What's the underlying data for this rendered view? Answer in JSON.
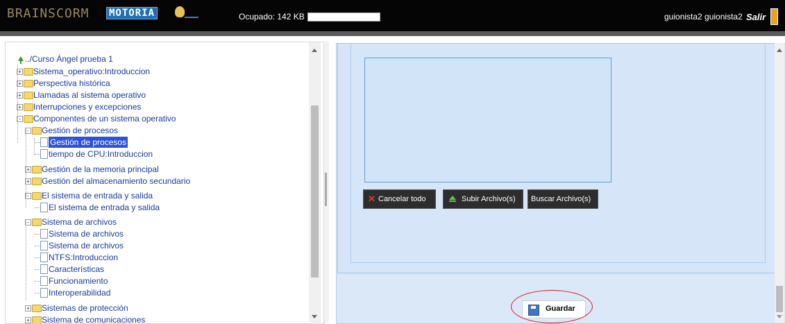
{
  "header": {
    "brand": "BRAINSCORM",
    "logo_text": "MOTORIA",
    "usage_text": "Ocupado: 142 KB",
    "usage_fraction": 1.0,
    "user_text": "guionista2 guionista2",
    "logout_label": "Salir",
    "colors": {
      "background": "#050505",
      "brand": "#9a8860",
      "logo": "#1f6fb5"
    }
  },
  "tree": {
    "root_label": "../Curso Ángel prueba 1",
    "nodes": [
      {
        "label": "Sistema_operativo:Introduccion",
        "type": "folder",
        "expander": "+"
      },
      {
        "label": "Perspectiva histórica",
        "type": "folder",
        "expander": "+"
      },
      {
        "label": "Llamadas al sistema operativo",
        "type": "folder",
        "expander": "+"
      },
      {
        "label": "Interrupciones y excepciones",
        "type": "folder",
        "expander": "+"
      },
      {
        "label": "Componentes de un sistema operativo",
        "type": "folder",
        "expander": "-"
      },
      {
        "label": "Gestión de procesos",
        "type": "folder",
        "expander": "-"
      },
      {
        "label": "Gestión de procesos",
        "type": "page",
        "selected": true
      },
      {
        "label": "tiempo de CPU:Introduccion",
        "type": "page"
      },
      {
        "label": "Gestión de la memoria principal",
        "type": "folder",
        "expander": "+"
      },
      {
        "label": "Gestión del almacenamiento secundario",
        "type": "folder",
        "expander": "+"
      },
      {
        "label": "El sistema de entrada y salida",
        "type": "folder",
        "expander": "-"
      },
      {
        "label": "El sistema de entrada y salida",
        "type": "page"
      },
      {
        "label": "Sistema de archivos",
        "type": "folder",
        "expander": "-"
      },
      {
        "label": "Sistema de archivos",
        "type": "page"
      },
      {
        "label": "Sistema de archivos",
        "type": "page"
      },
      {
        "label": "NTFS:Introduccion",
        "type": "page"
      },
      {
        "label": "Características",
        "type": "page"
      },
      {
        "label": "Funcionamiento",
        "type": "page"
      },
      {
        "label": "Interoperabilidad",
        "type": "page"
      },
      {
        "label": "Sistemas de protección",
        "type": "folder",
        "expander": "+"
      },
      {
        "label": "Sistema de comunicaciones",
        "type": "folder",
        "expander": "+"
      }
    ],
    "selected_color": "#2c53d6"
  },
  "upload": {
    "cancel_label": "Cancelar todo",
    "upload_label": "Subir Archivo(s)",
    "browse_label": "Buscar Archivo(s)"
  },
  "save": {
    "label": "Guardar",
    "highlight_color": "#d22020"
  }
}
